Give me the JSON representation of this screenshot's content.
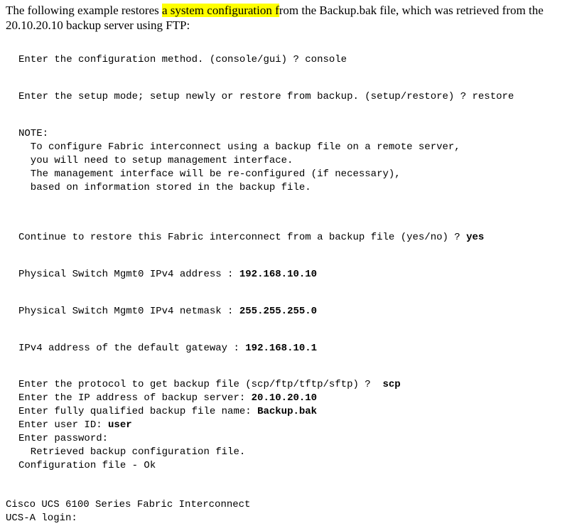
{
  "intro": {
    "pre": "The following example restores ",
    "highlight": "a system configuration f",
    "post": "rom the Backup.bak file, which was retrieved from the 20.10.20.10 backup server using FTP:"
  },
  "console": {
    "line_method": "Enter the configuration method. (console/gui) ? console",
    "line_mode": "Enter the setup mode; setup newly or restore from backup. (setup/restore) ? restore",
    "note_head": "NOTE:",
    "note_l1": "  To configure Fabric interconnect using a backup file on a remote server,",
    "note_l2": "  you will need to setup management interface.",
    "note_l3": "  The management interface will be re-configured (if necessary),",
    "note_l4": "  based on information stored in the backup file.",
    "cont_q": "Continue to restore this Fabric interconnect from a backup file (yes/no) ? ",
    "cont_a": "yes",
    "ipaddr_q": "Physical Switch Mgmt0 IPv4 address : ",
    "ipaddr_a": "192.168.10.10",
    "netmask_q": "Physical Switch Mgmt0 IPv4 netmask : ",
    "netmask_a": "255.255.255.0",
    "gw_q": "IPv4 address of the default gateway : ",
    "gw_a": "192.168.10.1",
    "proto_q": "Enter the protocol to get backup file (scp/ftp/tftp/sftp) ?  ",
    "proto_a": "scp",
    "srv_q": "Enter the IP address of backup server: ",
    "srv_a": "20.10.20.10",
    "file_q": "Enter fully qualified backup file name: ",
    "file_a": "Backup.bak",
    "uid_q": "Enter user ID: ",
    "uid_a": "user",
    "pwd_q": "Enter password:",
    "retr": "  Retrieved backup configuration file.",
    "cfgok": "Configuration file - Ok",
    "footer_l1": "Cisco UCS 6100 Series Fabric Interconnect",
    "footer_l2": "UCS-A login:"
  }
}
